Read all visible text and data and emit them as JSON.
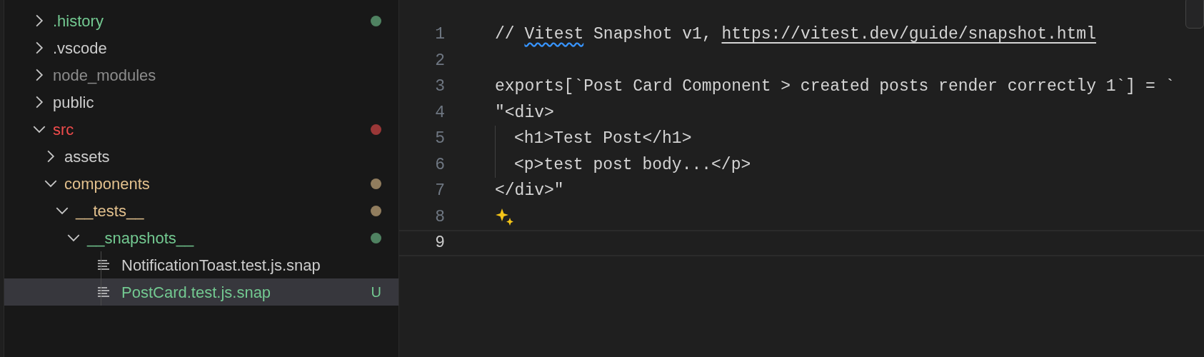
{
  "explorer": {
    "tree": [
      {
        "kind": "folder",
        "label": ".history",
        "color": "#73c991",
        "dot": true,
        "expanded": false,
        "selected": false
      },
      {
        "kind": "folder",
        "label": ".vscode",
        "color": "#cccccc",
        "dot": false,
        "expanded": false,
        "selected": false
      },
      {
        "kind": "folder",
        "label": "node_modules",
        "color": "#8c8c8c",
        "dot": false,
        "expanded": false,
        "selected": false
      },
      {
        "kind": "folder",
        "label": "public",
        "color": "#cccccc",
        "dot": false,
        "expanded": false,
        "selected": false
      },
      {
        "kind": "folder",
        "label": "src",
        "color": "#f14c4c",
        "dot": true,
        "expanded": true,
        "selected": false,
        "children": [
          {
            "kind": "folder",
            "label": "assets",
            "color": "#cccccc",
            "dot": false,
            "expanded": false,
            "selected": false
          },
          {
            "kind": "folder",
            "label": "components",
            "color": "#e2c08d",
            "dot": true,
            "expanded": true,
            "selected": false,
            "children": [
              {
                "kind": "folder",
                "label": "__tests__",
                "color": "#e2c08d",
                "dot": true,
                "expanded": true,
                "selected": false,
                "children": [
                  {
                    "kind": "folder",
                    "label": "__snapshots__",
                    "color": "#73c991",
                    "dot": true,
                    "expanded": true,
                    "selected": false,
                    "children": [
                      {
                        "kind": "file",
                        "label": "NotificationToast.test.js.snap",
                        "color": "#cccccc",
                        "dot": false,
                        "selected": false
                      },
                      {
                        "kind": "file",
                        "label": "PostCard.test.js.snap",
                        "color": "#73c991",
                        "dot": false,
                        "badge": "U",
                        "selected": true
                      }
                    ]
                  }
                ]
              }
            ]
          }
        ]
      }
    ]
  },
  "editor": {
    "lines": [
      {
        "number": "1",
        "current": false,
        "segments": [
          {
            "kind": "text",
            "text": "// "
          },
          {
            "kind": "spelling",
            "text": "Vitest"
          },
          {
            "kind": "text",
            "text": " Snapshot v1, "
          },
          {
            "kind": "link",
            "text": "https://vitest.dev/guide/snapshot.html"
          }
        ]
      },
      {
        "number": "2",
        "current": false
      },
      {
        "number": "3",
        "current": false,
        "segments": [
          {
            "kind": "text",
            "text": "exports[`Post Card Component > created posts render correctly 1`] = `"
          }
        ]
      },
      {
        "number": "4",
        "current": false,
        "segments": [
          {
            "kind": "text",
            "text": "\"<div>"
          }
        ]
      },
      {
        "number": "5",
        "current": false,
        "guide": true,
        "segments": [
          {
            "kind": "text",
            "text": "<h1>Test Post</h1>"
          }
        ]
      },
      {
        "number": "6",
        "current": false,
        "guide": true,
        "segments": [
          {
            "kind": "text",
            "text": "<p>test post body...</p>"
          }
        ]
      },
      {
        "number": "7",
        "current": false,
        "segments": [
          {
            "kind": "text",
            "text": "</div>\""
          }
        ]
      },
      {
        "number": "8",
        "current": false,
        "sparkle": true
      },
      {
        "number": "9",
        "current": true
      }
    ]
  }
}
